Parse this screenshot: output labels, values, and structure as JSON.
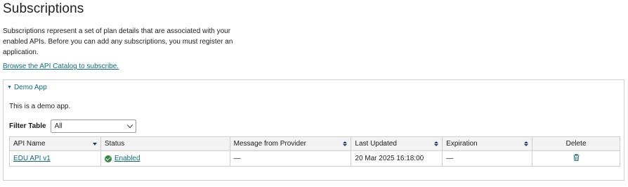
{
  "page": {
    "title": "Subscriptions",
    "intro": "Subscriptions represent a set of plan details that are associated with your enabled APIs. Before you can add any subscriptions, you must register an application.",
    "catalog_link": "Browse the API Catalog to subscribe."
  },
  "app": {
    "name": "Demo App",
    "description": "This is a demo app.",
    "filter": {
      "label": "Filter Table",
      "selected": "All"
    },
    "table": {
      "columns": {
        "api_name": "API Name",
        "status": "Status",
        "message": "Message from Provider",
        "last_updated": "Last Updated",
        "expiration": "Expiration",
        "delete": "Delete"
      },
      "rows": [
        {
          "api_name": "EDU API v1",
          "status": "Enabled",
          "message": "—",
          "last_updated": "20 Mar 2025 16:18:00",
          "expiration": "—"
        }
      ]
    }
  },
  "colors": {
    "link": "#0f6b7a",
    "status_ok": "#2e8b3e",
    "header_bg": "#f3f3f3"
  }
}
